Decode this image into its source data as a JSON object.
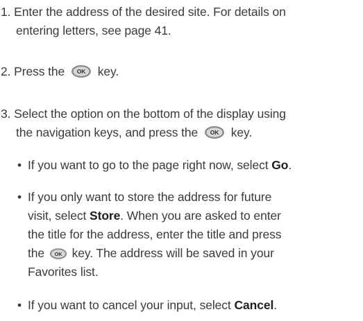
{
  "steps": [
    {
      "number": "1.",
      "line1": "Enter the address of the desired site. For details on",
      "line2": "entering letters, see page 41."
    },
    {
      "number": "2.",
      "before": "Press the",
      "after": "key."
    },
    {
      "number": "3.",
      "line1": "Select the option on the bottom of the display using",
      "line2_before": "the navigation keys, and press the",
      "line2_after": "key."
    }
  ],
  "bullets": [
    {
      "text_before": "If you want to go to the page right now, select ",
      "bold": "Go",
      "text_after": "."
    },
    {
      "line1_before": "If you only want to store the address for future",
      "line2_before": "visit, select ",
      "line2_bold": "Store",
      "line2_after": ". When you are asked to enter",
      "line3": "the title for the address, enter the title and press",
      "line4_before": "the",
      "line4_after": "key. The address will be saved in your",
      "line5": "Favorites list."
    },
    {
      "text_before": "If you want to cancel your input, select ",
      "bold": "Cancel",
      "text_after": "."
    }
  ],
  "icons": {
    "ok_key": "ok-key-icon",
    "ok_label": "OK"
  }
}
